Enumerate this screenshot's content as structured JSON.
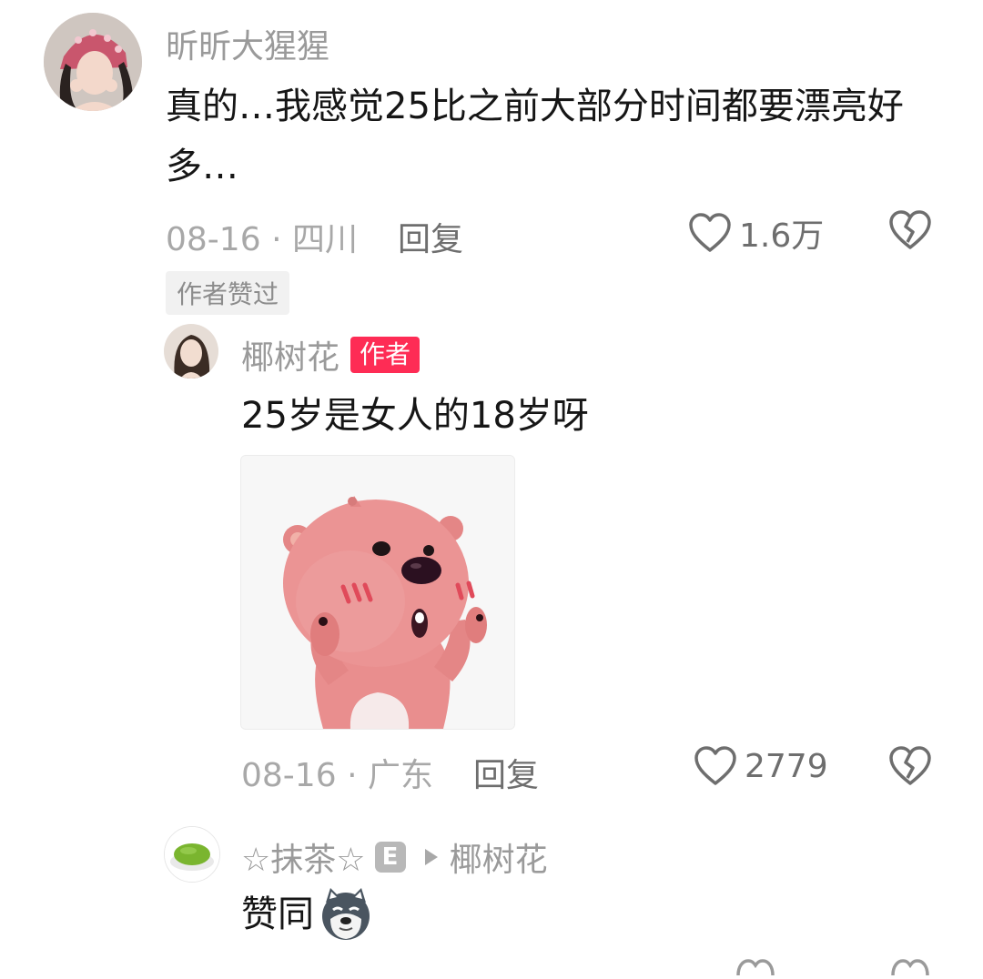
{
  "comment1": {
    "username": "昕昕大猩猩",
    "text": "真的…我感觉25比之前大部分时间都要漂亮好多…",
    "date": "08-16",
    "separator": "·",
    "location": "四川",
    "reply_label": "回复",
    "likes": "1.6万",
    "liked_by_author_tag": "作者赞过"
  },
  "reply1": {
    "username": "椰树花",
    "author_badge": "作者",
    "text": "25岁是女人的18岁呀",
    "date": "08-16",
    "separator": "·",
    "location": "广东",
    "reply_label": "回复",
    "likes": "2779"
  },
  "reply2": {
    "username": "☆抹茶☆",
    "level_badge": "E",
    "reply_to": "椰树花",
    "text": "赞同"
  },
  "icons": {
    "like": "heart-outline-icon",
    "dislike": "broken-heart-icon",
    "reply_arrow": "triangle-right-icon",
    "emoji": "doge-emoji-icon"
  },
  "colors": {
    "author_badge_bg": "#fe2c55",
    "meta_gray": "#a8a8a8",
    "text": "#161616"
  }
}
